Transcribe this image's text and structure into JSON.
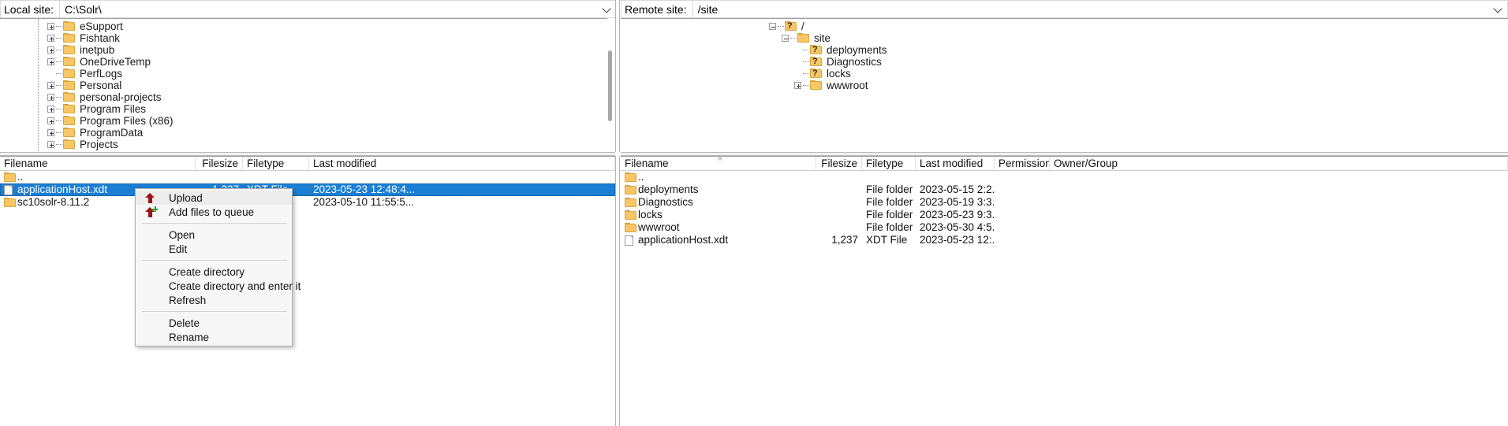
{
  "local": {
    "site_label": "Local site:",
    "site_path": "C:\\Solr\\",
    "tree": [
      {
        "label": "eSupport",
        "expander": "plus",
        "indent": 1
      },
      {
        "label": "Fishtank",
        "expander": "plus",
        "indent": 1
      },
      {
        "label": "inetpub",
        "expander": "plus",
        "indent": 1
      },
      {
        "label": "OneDriveTemp",
        "expander": "plus",
        "indent": 1
      },
      {
        "label": "PerfLogs",
        "expander": "none",
        "indent": 1
      },
      {
        "label": "Personal",
        "expander": "plus",
        "indent": 1
      },
      {
        "label": "personal-projects",
        "expander": "plus",
        "indent": 1
      },
      {
        "label": "Program Files",
        "expander": "plus",
        "indent": 1
      },
      {
        "label": "Program Files (x86)",
        "expander": "plus",
        "indent": 1
      },
      {
        "label": "ProgramData",
        "expander": "plus",
        "indent": 1
      },
      {
        "label": "Projects",
        "expander": "plus",
        "indent": 1
      }
    ],
    "columns": [
      {
        "label": "Filename",
        "align": "left"
      },
      {
        "label": "Filesize",
        "align": "right"
      },
      {
        "label": "Filetype",
        "align": "left"
      },
      {
        "label": "Last modified",
        "align": "left"
      }
    ],
    "rows": [
      {
        "icon": "folder-icon",
        "filename": "..",
        "filesize": "",
        "filetype": "",
        "modified": "",
        "selected": false
      },
      {
        "icon": "file-icon",
        "filename": "applicationHost.xdt",
        "filesize": "1,237",
        "filetype": "XDT File",
        "modified": "2023-05-23 12:48:4...",
        "selected": true
      },
      {
        "icon": "folder-icon",
        "filename": "sc10solr-8.11.2",
        "filesize": "",
        "filetype": "",
        "modified": "2023-05-10 11:55:5...",
        "selected": false
      }
    ]
  },
  "remote": {
    "site_label": "Remote site:",
    "site_path": "/site",
    "tree": [
      {
        "label": "/",
        "expander": "minus",
        "indent": 0,
        "icon": "unknown-folder-icon"
      },
      {
        "label": "site",
        "expander": "minus",
        "indent": 1,
        "icon": "folder-icon"
      },
      {
        "label": "deployments",
        "expander": "none",
        "indent": 2,
        "icon": "unknown-folder-icon"
      },
      {
        "label": "Diagnostics",
        "expander": "none",
        "indent": 2,
        "icon": "unknown-folder-icon"
      },
      {
        "label": "locks",
        "expander": "none",
        "indent": 2,
        "icon": "unknown-folder-icon"
      },
      {
        "label": "wwwroot",
        "expander": "plus",
        "indent": 2,
        "icon": "folder-icon"
      }
    ],
    "columns": [
      {
        "label": "Filename",
        "align": "left"
      },
      {
        "label": "Filesize",
        "align": "right"
      },
      {
        "label": "Filetype",
        "align": "left"
      },
      {
        "label": "Last modified",
        "align": "left"
      },
      {
        "label": "Permissions",
        "align": "left"
      },
      {
        "label": "Owner/Group",
        "align": "left"
      }
    ],
    "sort_indicator": "^",
    "rows": [
      {
        "icon": "folder-icon",
        "filename": "..",
        "filesize": "",
        "filetype": "",
        "modified": "",
        "permissions": "",
        "owner": ""
      },
      {
        "icon": "folder-icon",
        "filename": "deployments",
        "filesize": "",
        "filetype": "File folder",
        "modified": "2023-05-15 2:2...",
        "permissions": "",
        "owner": ""
      },
      {
        "icon": "folder-icon",
        "filename": "Diagnostics",
        "filesize": "",
        "filetype": "File folder",
        "modified": "2023-05-19 3:3...",
        "permissions": "",
        "owner": ""
      },
      {
        "icon": "folder-icon",
        "filename": "locks",
        "filesize": "",
        "filetype": "File folder",
        "modified": "2023-05-23 9:3...",
        "permissions": "",
        "owner": ""
      },
      {
        "icon": "folder-icon",
        "filename": "wwwroot",
        "filesize": "",
        "filetype": "File folder",
        "modified": "2023-05-30 4:5...",
        "permissions": "",
        "owner": ""
      },
      {
        "icon": "file-icon",
        "filename": "applicationHost.xdt",
        "filesize": "1,237",
        "filetype": "XDT File",
        "modified": "2023-05-23 12:...",
        "permissions": "",
        "owner": ""
      }
    ]
  },
  "context_menu": {
    "items": [
      {
        "label": "Upload",
        "icon": "upload-arrow-icon",
        "highlighted": true,
        "separator_after": false
      },
      {
        "label": "Add files to queue",
        "icon": "add-to-queue-icon",
        "highlighted": false,
        "separator_after": true
      },
      {
        "label": "Open",
        "icon": "",
        "highlighted": false,
        "separator_after": false
      },
      {
        "label": "Edit",
        "icon": "",
        "highlighted": false,
        "separator_after": true
      },
      {
        "label": "Create directory",
        "icon": "",
        "highlighted": false,
        "separator_after": false
      },
      {
        "label": "Create directory and enter it",
        "icon": "",
        "highlighted": false,
        "separator_after": false
      },
      {
        "label": "Refresh",
        "icon": "",
        "highlighted": false,
        "separator_after": true
      },
      {
        "label": "Delete",
        "icon": "",
        "highlighted": false,
        "separator_after": false
      },
      {
        "label": "Rename",
        "icon": "",
        "highlighted": false,
        "separator_after": false
      }
    ]
  },
  "colors": {
    "selection": "#1a7fd4",
    "folder": "#f7c767",
    "upload_arrow": "#9d1414",
    "plus_badge": "#1faa2a"
  }
}
